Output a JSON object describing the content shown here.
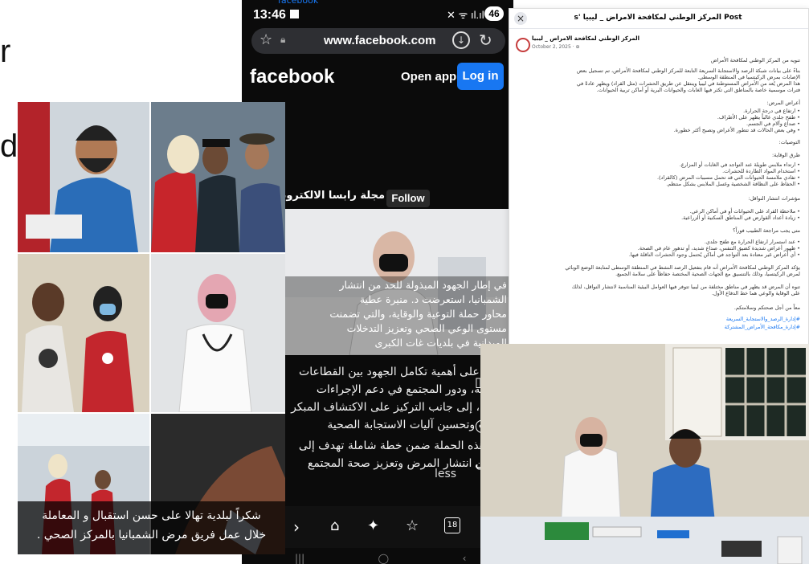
{
  "left_fragment": {
    "letter_top": "r",
    "letter_bottom": "d"
  },
  "collage": {
    "caption_line1": "شكراً لبلدية تهالا على حسن استقبال و المعاملة",
    "caption_line2": "خلال عمل فريق مرض الشمبانيا بالمركز الصحي ."
  },
  "phone": {
    "time": "13:46",
    "battery": "46",
    "top_link": "facebook",
    "url": "www.facebook.com",
    "brand": "facebook",
    "open_app": "Open app",
    "login": "Log in",
    "page_name": "مجلة رابسا الالكترونية",
    "follow": "Follow",
    "overlay_text": [
      "في إطار الجهود المبذولة للحد من انتشار",
      "الشمبانيا، استعرضت د. منيرة عطية",
      "محاور حملة التوعية والوقاية، والتي تضمنت",
      "مستوى الوعي الصحي وتعزيز التدخلات",
      "الميدانية في بلديات غات الكبرى"
    ],
    "para1": [
      "وأكدت على أهمية تكامل الجهود بين القطاعات",
      "المختلفة، ودور المجتمع في دعم الإجراءات",
      "الوقائية، إلى جانب التركيز على الاكتشاف المبكر",
      "للحالات وتحسين آليات الاستجابة الصحية"
    ],
    "para2": [
      "وتأتي هذه الحملة ضمن خطة شاملة تهدف إلى",
      "الحد من انتشار المرض وتعزيز صحة المجتمع"
    ],
    "see_less": "less"
  },
  "fb_post": {
    "header_title": "Post المركز الوطني لمكافحة الامراض _ ليبيا 's",
    "close": "×",
    "author": "المركز الوطني لمكافحة الامراض _ ليبيا",
    "date": "October 2, 2025 · ⊕",
    "lines": [
      "تنويه من المركز الوطني لمكافحة الأمراض",
      "بناءً على بيانات شبكة الرصد والاستجابة السريعة التابعة للمركز الوطني لمكافحة الأمراض، تم تسجيل بعض",
      "الإصابات بمرض الركيتسيا في المنطقة الوسطى.",
      "هذا المرض يُعد من الأمراض المستوطنة في ليبيا وينتقل عن طريق الحشرات (مثل القراد) ويظهر عادةً في",
      "فترات موسمية خاصة بالمناطق التي تكثر فيها الغابات والحيوانات البرية أو أماكن تربية الحيوانات.",
      "أعراض المرض:",
      "• ارتفاع في درجة الحرارة.",
      "• طفح جلدي غالباً يظهر على الأطراف.",
      "• صداع وآلام في الجسم.",
      "• وفي بعض الحالات قد تتطور الأعراض وتصبح أكثر خطورة.",
      "التوصيات:",
      "طرق الوقاية:",
      "• ارتداء ملابس طويلة عند التواجد في الغابات أو المزارع.",
      "• استخدام المواد الطاردة للحشرات.",
      "• تفادي ملامسة الحيوانات التي قد تحمل مسببات المرض (كالقراد).",
      "• الحفاظ على النظافة الشخصية وغسل الملابس بشكل منتظم.",
      "مؤشرات انتشار النواقل:",
      "• ملاحظة القراد على الحيوانات أو في أماكن الرعي.",
      "• زيادة أعداد القوارض في المناطق السكنية أو الزراعية.",
      "متى يجب مراجعة الطبيب فوراً؟",
      "• عند استمرار ارتفاع الحرارة مع طفح جلدي.",
      "• ظهور أعراض شديدة كضيق التنفس، صداع شديد، أو تدهور عام في الصحة.",
      "• أي أعراض غير معتادة بعد التواجد في أماكن يُحتمل وجود الحشرات الناقلة فيها.",
      "يؤكد المركز الوطني لمكافحة الأمراض أنه قام بتفعيل الرصد النشط في المنطقة الوسطى لمتابعة الوضع الوبائي",
      "لمرض الركيتسيا، وذلك بالتنسيق مع الجهات الصحية المختصة حفاظاً على سلامة الجميع.",
      "تنوه أن المرض قد يظهر في مناطق مختلفة من ليبيا تتوفر فيها العوامل البيئية المناسبة لانتشار النواقل، لذلك",
      "على الوقاية والوعي هما خط الدفاع الأول.",
      "معاً من أجل صحتكم وسلامتكم.",
      "#إدارة_الرصد_والاستجابة_السريعة",
      "#إدارة_مكافحة_الأمراض_المشتركة"
    ]
  },
  "colors": {
    "fb_blue": "#1877f2",
    "phone_bg": "#0b0b0b"
  }
}
